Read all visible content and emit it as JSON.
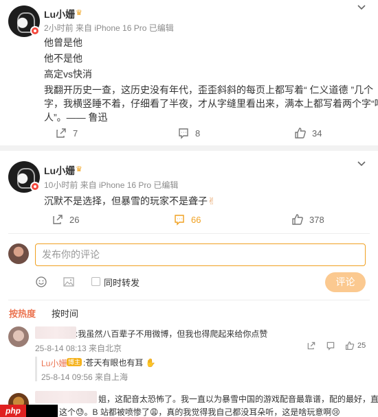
{
  "post1": {
    "username": "Lu小姗",
    "meta": "2小时前 来自 iPhone 16 Pro 已编辑",
    "lines": [
      "他曾是他",
      "他不是他",
      "高定vs快消",
      "我翻开历史一查，这历史没有年代，歪歪斜斜的每页上都写着“ 仁义道德 ”几个",
      "字，我横竖睡不着，仔细看了半夜，才从字缝里看出来，满本上都写着两个字“吃",
      "人”。—— 鲁迅"
    ],
    "repost_count": "7",
    "comment_count": "8",
    "like_count": "34"
  },
  "post2": {
    "username": "Lu小姗",
    "meta": "10小时前 来自 iPhone 16 Pro 已编辑",
    "text": "沉默不是选择，但暴雪的玩家不是聋子",
    "emoji": "✌",
    "repost_count": "26",
    "comment_count": "66",
    "like_count": "378"
  },
  "compose": {
    "placeholder": "发布你的评论",
    "also_repost": "同时转发",
    "submit": "评论"
  },
  "tabs": {
    "hot": "按热度",
    "time": "按时间"
  },
  "comments": [
    {
      "text": ":我虽然八百辈子不用微博，但我也得爬起来给你点赞",
      "meta": "25-8-14 08:13 来自北京",
      "likes": "25",
      "reply": {
        "username": "Lu小姗",
        "badge": "博主",
        "text": ":苍天有眼也有耳",
        "meta": "25-8-14 09:56 来自上海"
      }
    },
    {
      "line1": "姐，这配音太恐怖了。我一直以为暴雪中国的游戏配音最靠谱，配的最好，直",
      "line2": "这个😓。B 站都被喷惨了😩，真的我觉得我自己都没耳朵听，这是啥玩意啊😢"
    }
  ],
  "colors": {
    "accent": "#f0a020",
    "hot_tab": "#eb7350",
    "link": "#eb7350"
  },
  "watermark": "php"
}
